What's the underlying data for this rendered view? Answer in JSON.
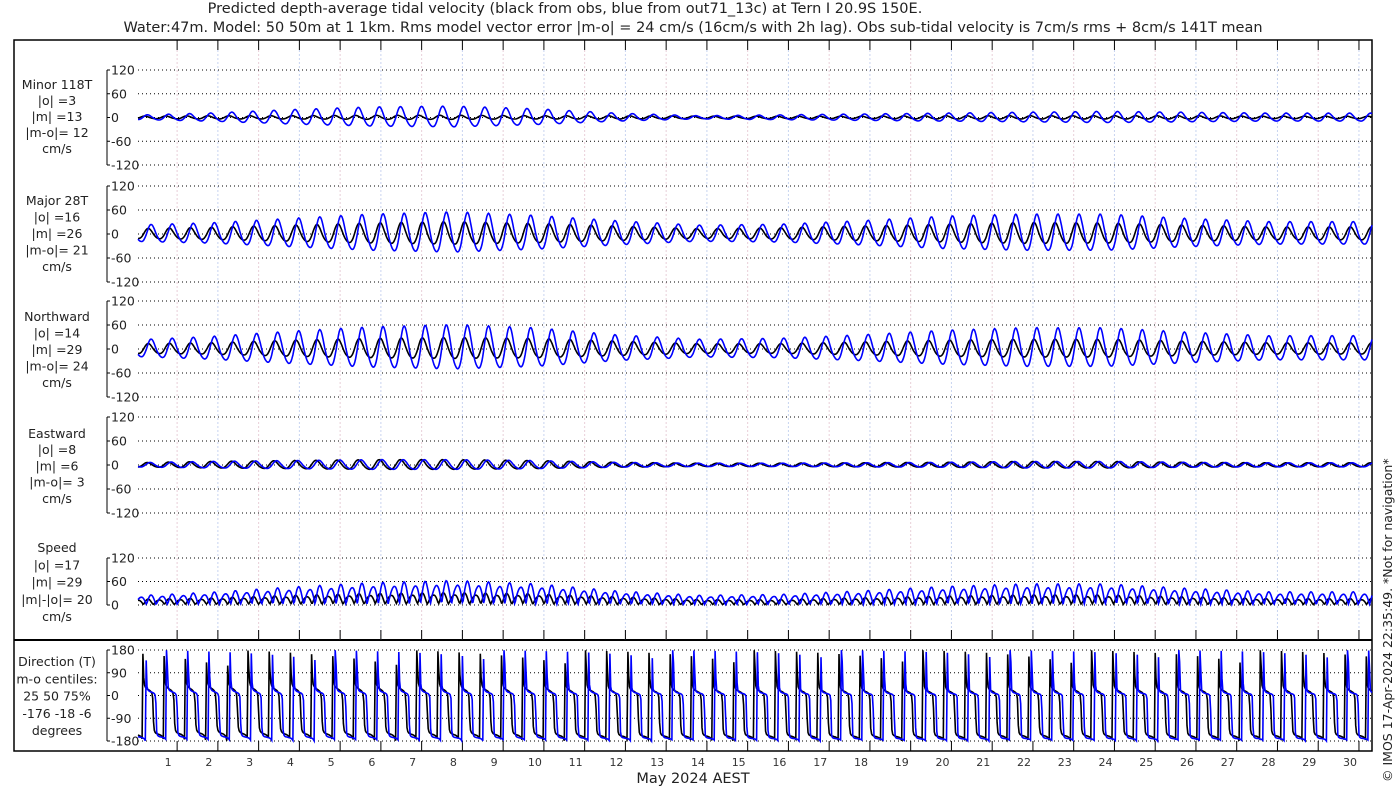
{
  "chart_data": {
    "type": "line",
    "title": "Predicted depth-average tidal velocity (black from obs, blue from out71_13c) at Tern I 20.9S 150E.",
    "subtitle": "Water:47m. Model: 50 50m at 1 1km. Rms model vector error |m-o| = 24 cm/s (16cm/s with 2h lag). Obs sub-tidal velocity is 7cm/s rms + 8cm/s 141T mean",
    "xlabel": "May 2024 AEST",
    "xlim": [
      0.26,
      30.54
    ],
    "day_labels": [
      "1",
      "2",
      "3",
      "4",
      "5",
      "6",
      "7",
      "8",
      "9",
      "10",
      "11",
      "12",
      "13",
      "14",
      "15",
      "16",
      "17",
      "18",
      "19",
      "20",
      "21",
      "22",
      "23",
      "24",
      "25",
      "26",
      "27",
      "28",
      "29",
      "30"
    ],
    "footer": "© IMOS 17-Apr-2024 22:35:49. *Not for navigation*",
    "tidal_period_days": 0.5175,
    "model_lag_days": 0.07,
    "envelope_days": [
      0,
      2,
      4,
      6,
      8,
      10,
      12,
      14,
      16,
      18,
      20,
      22,
      24,
      26,
      28,
      30,
      31
    ],
    "series_colors": {
      "obs": "#000000",
      "model": "#0000ff"
    },
    "panels": [
      {
        "key": "minor",
        "label": [
          "Minor 118T",
          "|o| =3",
          "|m| =13",
          "|m-o|= 12",
          "cm/s"
        ],
        "ylim": [
          -120,
          120
        ],
        "yticks": [
          "120",
          "60",
          "0",
          "-60",
          "-120"
        ],
        "obs_amp": [
          3,
          4,
          4,
          5,
          5,
          4,
          4,
          3,
          3,
          3,
          4,
          4,
          4,
          4,
          3,
          3,
          3
        ],
        "model_amp": [
          5,
          10,
          18,
          24,
          26,
          20,
          10,
          4,
          6,
          8,
          10,
          12,
          14,
          12,
          10,
          10,
          10
        ]
      },
      {
        "key": "major",
        "label": [
          "Major 28T",
          "|o| =16",
          "|m| =26",
          "|m-o|= 21",
          "cm/s"
        ],
        "ylim": [
          -120,
          120
        ],
        "yticks": [
          "120",
          "60",
          "0",
          "-60",
          "-120"
        ],
        "obs_amp": [
          12,
          15,
          20,
          25,
          28,
          24,
          18,
          12,
          14,
          18,
          22,
          26,
          25,
          20,
          16,
          16,
          16
        ],
        "model_amp": [
          20,
          25,
          35,
          45,
          50,
          42,
          30,
          20,
          22,
          30,
          40,
          45,
          45,
          35,
          28,
          28,
          28
        ]
      },
      {
        "key": "north",
        "label": [
          "Northward",
          "|o| =14",
          "|m| =29",
          "|m-o|= 24",
          "cm/s"
        ],
        "ylim": [
          -120,
          120
        ],
        "yticks": [
          "120",
          "60",
          "0",
          "-60",
          "-120"
        ],
        "obs_amp": [
          12,
          14,
          20,
          24,
          26,
          24,
          18,
          12,
          12,
          16,
          20,
          22,
          22,
          18,
          14,
          14,
          14
        ],
        "model_amp": [
          20,
          28,
          40,
          50,
          55,
          48,
          32,
          22,
          24,
          32,
          42,
          48,
          48,
          38,
          30,
          30,
          30
        ]
      },
      {
        "key": "east",
        "label": [
          "Eastward",
          "|o| =8",
          "|m| =6",
          "|m-o|= 3",
          "cm/s"
        ],
        "ylim": [
          -120,
          120
        ],
        "yticks": [
          "120",
          "60",
          "0",
          "-60",
          "-120"
        ],
        "obs_amp": [
          5,
          8,
          10,
          12,
          12,
          10,
          6,
          4,
          4,
          5,
          6,
          8,
          8,
          6,
          5,
          5,
          5
        ],
        "model_amp": [
          5,
          8,
          10,
          12,
          12,
          10,
          6,
          4,
          4,
          5,
          6,
          8,
          8,
          6,
          5,
          5,
          5
        ]
      },
      {
        "key": "speed",
        "label": [
          "Speed",
          "|o| =17",
          "|m| =29",
          "|m|-|o|= 20",
          "cm/s"
        ],
        "ylim": [
          0,
          120
        ],
        "yticks": [
          "120",
          "60",
          "0"
        ],
        "derived": "sqrt(north^2+east^2)"
      },
      {
        "key": "direction",
        "label": [
          "Direction (T)",
          "m-o centiles:",
          "25  50  75%",
          "-176  -18    -6",
          "degrees"
        ],
        "ylim": [
          -180,
          180
        ],
        "yticks": [
          "180",
          "90",
          "0",
          "-90",
          "-180"
        ],
        "derived": "atan2(east,north)"
      }
    ]
  }
}
